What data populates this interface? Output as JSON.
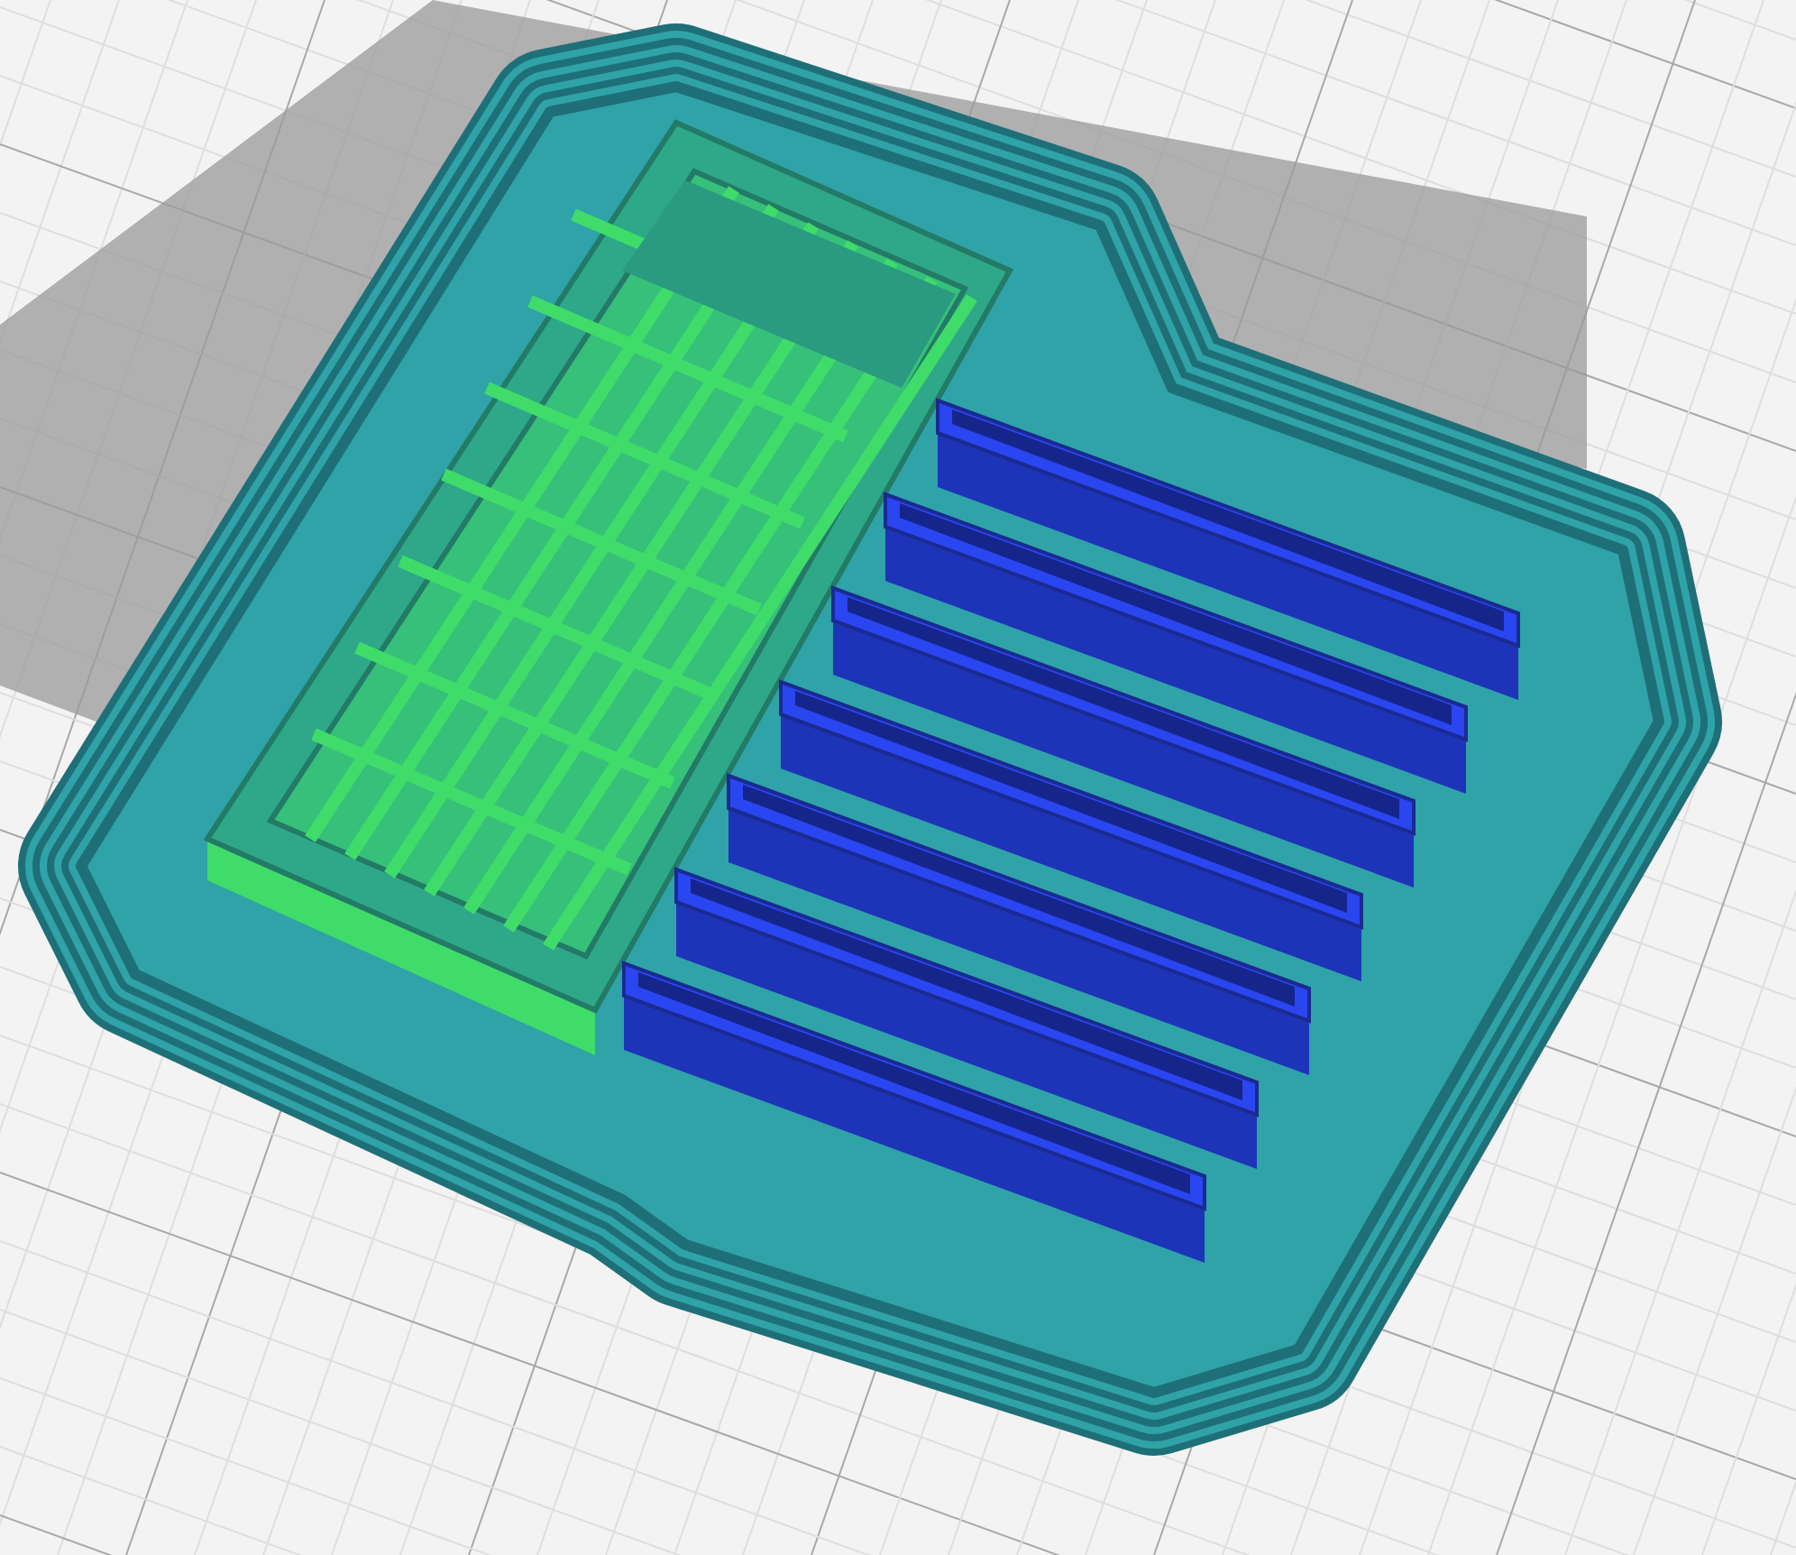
{
  "viewport": {
    "models": [
      {
        "kind": "lattice-box",
        "color": "#3fdc6a"
      },
      {
        "kind": "ribbed-box",
        "color": "#2a46f0"
      }
    ]
  }
}
